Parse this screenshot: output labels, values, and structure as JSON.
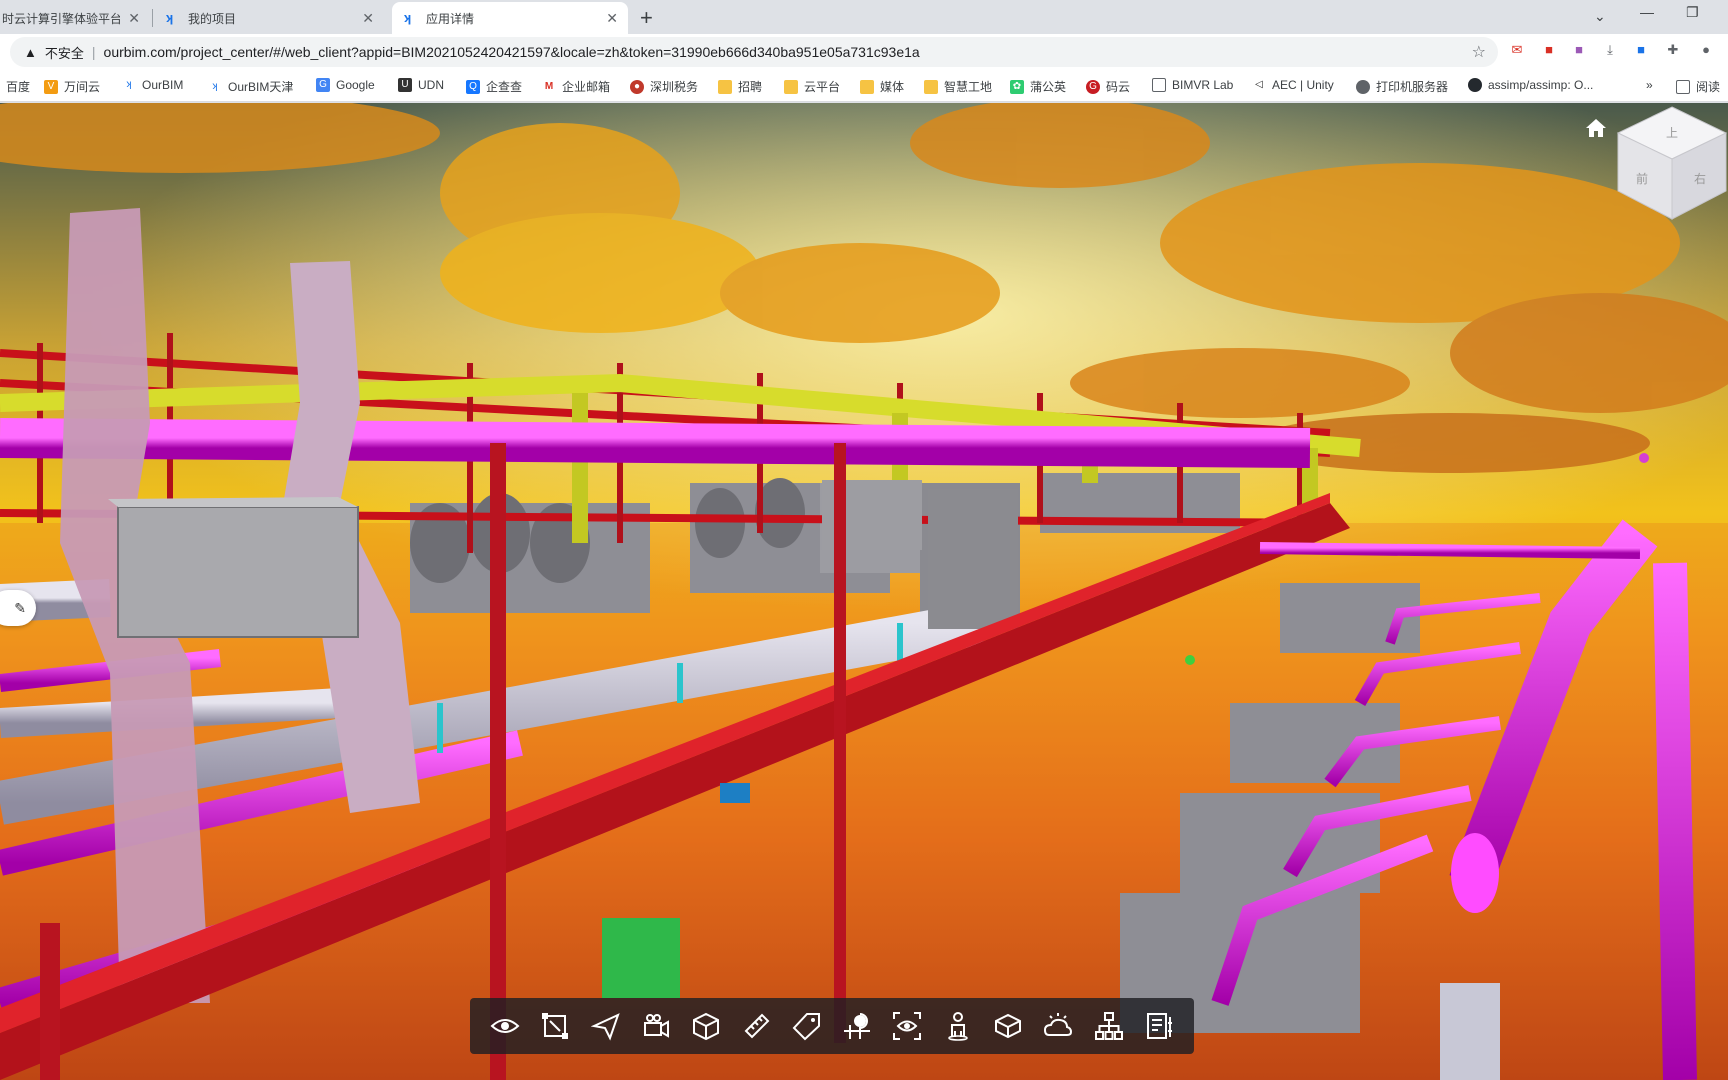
{
  "browser": {
    "tabs": [
      {
        "title": "时云计算引擎体验平台",
        "active": false
      },
      {
        "title": "我的项目",
        "active": false
      },
      {
        "title": "应用详情",
        "active": true
      }
    ],
    "address": {
      "security_label": "不安全",
      "url": "ourbim.com/project_center/#/web_client?appid=BIM2021052420421597&locale=zh&token=31990eb666d340ba951e05a731c93e1a"
    },
    "bookmarks": [
      {
        "label": "百度",
        "icon": "baidu-icon",
        "color": "#2932e1"
      },
      {
        "label": "万间云",
        "icon": "wanjian-icon",
        "color": "#f39c12"
      },
      {
        "label": "OurBIM",
        "icon": "ourbim-icon",
        "color": "#1a73e8"
      },
      {
        "label": "OurBIM天津",
        "icon": "ourbim-icon",
        "color": "#1a73e8"
      },
      {
        "label": "Google",
        "icon": "google-icon",
        "color": "#4285f4"
      },
      {
        "label": "UDN",
        "icon": "udn-icon",
        "color": "#333333"
      },
      {
        "label": "企查查",
        "icon": "qichacha-icon",
        "color": "#1677ff"
      },
      {
        "label": "企业邮箱",
        "icon": "mail-icon",
        "color": "#d93025"
      },
      {
        "label": "深圳税务",
        "icon": "tax-icon",
        "color": "#c0392b"
      },
      {
        "label": "招聘",
        "icon": "folder-icon",
        "color": "#f6c343"
      },
      {
        "label": "云平台",
        "icon": "folder-icon",
        "color": "#f6c343"
      },
      {
        "label": "媒体",
        "icon": "folder-icon",
        "color": "#f6c343"
      },
      {
        "label": "智慧工地",
        "icon": "folder-icon",
        "color": "#f6c343"
      },
      {
        "label": "蒲公英",
        "icon": "pgyer-icon",
        "color": "#2ecc71"
      },
      {
        "label": "码云",
        "icon": "gitee-icon",
        "color": "#c71d23"
      },
      {
        "label": "BIMVR Lab",
        "icon": "page-icon",
        "color": "#5f6368"
      },
      {
        "label": "AEC | Unity",
        "icon": "unity-icon",
        "color": "#222222"
      },
      {
        "label": "打印机服务器",
        "icon": "globe-icon",
        "color": "#5f6368"
      },
      {
        "label": "assimp/assimp: O...",
        "icon": "github-icon",
        "color": "#24292e"
      }
    ],
    "more_label": "»",
    "reading_list_label": "阅读"
  },
  "viewer": {
    "toolbar": [
      {
        "name": "visibility",
        "icon": "eye-icon"
      },
      {
        "name": "section-box",
        "icon": "section-box-icon"
      },
      {
        "name": "roam",
        "icon": "paper-plane-icon"
      },
      {
        "name": "camera",
        "icon": "camera-icon"
      },
      {
        "name": "model-cube",
        "icon": "cube-icon"
      },
      {
        "name": "measure",
        "icon": "ruler-icon"
      },
      {
        "name": "tag",
        "icon": "tag-icon"
      },
      {
        "name": "location",
        "icon": "pin-icon"
      },
      {
        "name": "view-focus",
        "icon": "focus-eye-icon"
      },
      {
        "name": "person",
        "icon": "person-icon"
      },
      {
        "name": "explode",
        "icon": "box-icon"
      },
      {
        "name": "weather",
        "icon": "weather-icon"
      },
      {
        "name": "structure-tree",
        "icon": "tree-icon"
      },
      {
        "name": "properties",
        "icon": "properties-icon"
      }
    ],
    "navcube_faces": [
      "上",
      "前",
      "右"
    ]
  }
}
